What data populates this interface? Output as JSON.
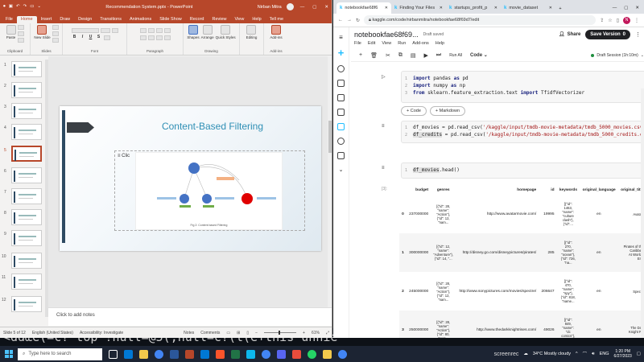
{
  "ppt": {
    "title": "Recommendation System.pptx - PowerPoint",
    "user": "Nirban Mitra",
    "menus": [
      "File",
      "Home",
      "Insert",
      "Draw",
      "Design",
      "Transitions",
      "Animations",
      "Slide Show",
      "Record",
      "Review",
      "View",
      "Help"
    ],
    "tell_me": "Tell me",
    "ribbon": {
      "paste": "Paste",
      "new_slide": "New Slide",
      "shapes": "Shapes",
      "arrange": "Arrange",
      "quick_styles": "Quick Styles",
      "editing": "Editing",
      "add_ins": "Add-ins",
      "groups": [
        "Clipboard",
        "Slides",
        "Font",
        "Paragraph",
        "Drawing",
        "Add-ins"
      ]
    },
    "slide_numbers": [
      "1",
      "2",
      "3",
      "4",
      "5",
      "6",
      "7",
      "8",
      "9",
      "10",
      "11",
      "12"
    ],
    "slide": {
      "title": "Content-Based Filtering",
      "placeholder_text": "Clic",
      "caption": "Fig 2: Content based Filtering"
    },
    "notes_placeholder": "Click to add notes",
    "status": {
      "slide_of": "Slide 5 of 12",
      "language": "English (United States)",
      "accessibility": "Accessibility: Investigate",
      "notes": "Notes",
      "comments": "Comments",
      "zoom": "61%"
    }
  },
  "chrome": {
    "tabs": [
      {
        "label": "notebookfae68f6",
        "active": true
      },
      {
        "label": "Finding Your Files",
        "active": false
      },
      {
        "label": "startups_profit_p",
        "active": false
      },
      {
        "label": "movie_dataset",
        "active": false
      }
    ],
    "url": "kaggle.com/code/nirbanmitra/notebookfae68f69d7/edit",
    "avatar_letter": "N"
  },
  "kaggle": {
    "notebook_title": "notebookfae68f69...",
    "status": "Draft saved",
    "share": "Share",
    "save_version": "Save Version",
    "save_count": "0",
    "menu": [
      "File",
      "Edit",
      "View",
      "Run",
      "Add-ons",
      "Help"
    ],
    "run_all": "Run All",
    "cell_type": "Code",
    "session": "Draft Session (1h:10m)",
    "add_code": "+ Code",
    "add_markdown": "+ Markdown",
    "output_label": "[3]:",
    "columns": [
      "",
      "budget",
      "genres",
      "homepage",
      "id",
      "keywords",
      "original_language",
      "original_titl"
    ],
    "rows": [
      {
        "idx": "0",
        "budget": "237000000",
        "genres": "[{\"id\": 28,\n\"name\":\n\"Action\"},\n{\"id\": 12,\n\"nam...",
        "homepage": "http://www.avatarmovie.com/",
        "id": "19995",
        "keywords": "[{\"id\":\n1463,\n\"name\":\n\"culture\nclash\"},\n{\"id\":...",
        "lang": "en",
        "title": "Avata"
      },
      {
        "idx": "1",
        "budget": "300000000",
        "genres": "[{\"id\": 12,\n\"name\":\n\"Adventure\"},\n{\"id\": 14, \"...",
        "homepage": "http://disney.go.com/disneypictures/pirates/",
        "id": "285",
        "keywords": "[{\"id\":\n270,\n\"name\":\n\"ocean\"},\n{\"id\": 726,\n\"na...",
        "lang": "en",
        "title": "Pirates of th\nCaribbe\nAt World\nEn"
      },
      {
        "idx": "2",
        "budget": "245000000",
        "genres": "[{\"id\": 28,\n\"name\":\n\"Action\"},\n{\"id\": 12,\n\"nam...",
        "homepage": "http://www.sonypictures.com/movies/spectre/",
        "id": "206647",
        "keywords": "[{\"id\":\n470,\n\"name\":\n\"spy\"},\n{\"id\": 818,\n\"name...",
        "lang": "en",
        "title": "Spect"
      },
      {
        "idx": "3",
        "budget": "250000000",
        "genres": "[{\"id\": 28,\n\"name\":\n\"Action\"},\n{\"id\": 80,\n\"nam...",
        "homepage": "http://www.thedarkknightrises.com/",
        "id": "49026",
        "keywords": "[{\"id\":\n849,\n\"name\":\n\"dc\ncomics\"},\n{\"id\":...",
        "lang": "en",
        "title": "The Da\nKnight R"
      }
    ]
  },
  "taskbar": {
    "search_placeholder": "Type here to search",
    "screenrec": "screenrec",
    "weather": "34°C  Mostly cloudy",
    "lang": "ENG",
    "time": "1:20 PM",
    "date": "6/27/2023"
  },
  "desktop_code": "<ddœe(=c?\"top\"!null=@5(;null=c?(l(e+this unnie"
}
